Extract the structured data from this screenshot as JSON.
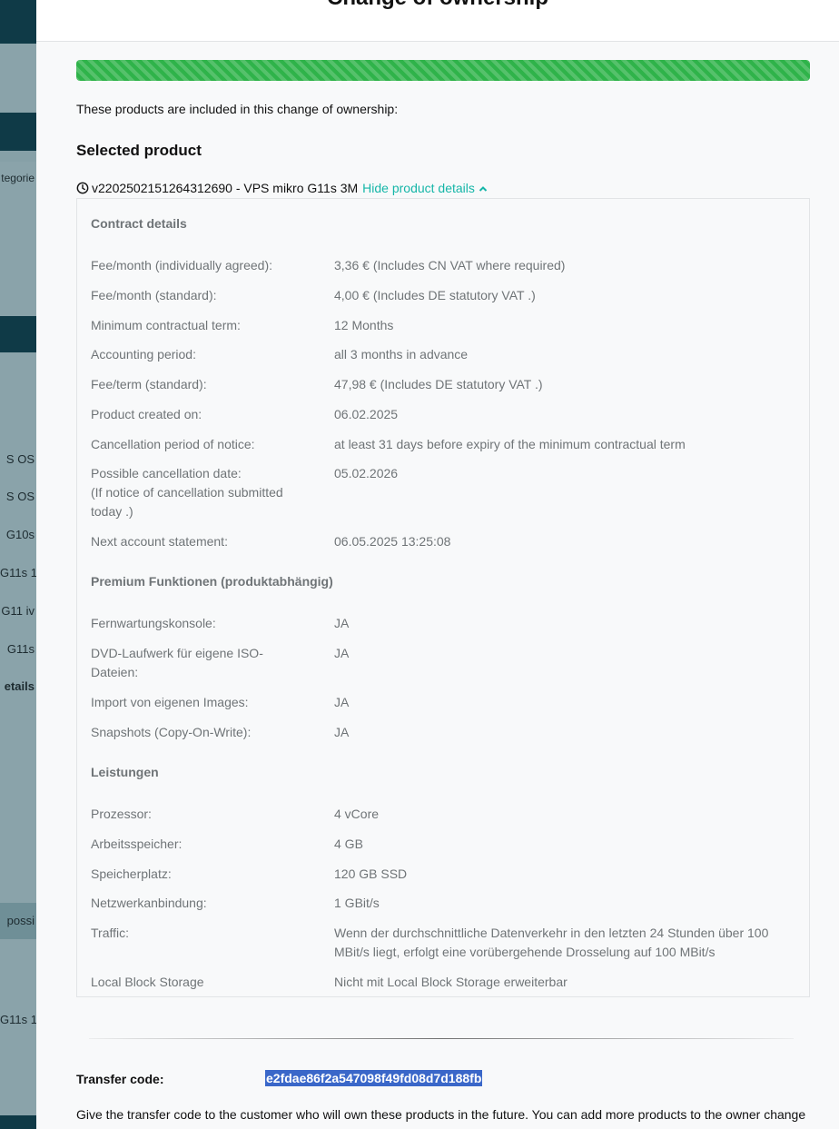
{
  "background": {
    "rows": [
      {
        "text": ""
      },
      {
        "text": ""
      },
      {
        "text": ""
      },
      {
        "text": "tegorie"
      },
      {
        "text": ""
      },
      {
        "text": ""
      },
      {
        "text": ""
      },
      {
        "text": ""
      },
      {
        "text": ""
      },
      {
        "text": ""
      },
      {
        "text": "S OS"
      },
      {
        "text": "S OS"
      },
      {
        "text": "G10s"
      },
      {
        "text": "G11s 1"
      },
      {
        "text": "G11 iv"
      },
      {
        "text": "G11s"
      },
      {
        "text": "etails"
      },
      {
        "text": ""
      },
      {
        "text": "possi"
      },
      {
        "text": ""
      },
      {
        "text": ""
      },
      {
        "text": "G11s 1"
      },
      {
        "text": ""
      },
      {
        "text": ""
      }
    ]
  },
  "modal": {
    "title": "Change of ownership",
    "progress_percent": 100,
    "intro": "These products are included in this change of ownership:",
    "section_title": "Selected product",
    "product": {
      "id_name": "v2202502151264312690 - VPS mikro G11s 3M",
      "toggle_label": "Hide product details"
    },
    "contract": {
      "title": "Contract details",
      "rows": [
        {
          "label": "Fee/month (individually agreed):",
          "value": "3,36 € (Includes CN VAT where required)"
        },
        {
          "label": "Fee/month (standard):",
          "value": "4,00 € (Includes DE statutory VAT .)"
        },
        {
          "label": "Minimum contractual term:",
          "value": "12 Months"
        },
        {
          "label": "Accounting period:",
          "value": "all 3 months in advance"
        },
        {
          "label": "Fee/term (standard):",
          "value": "47,98 € (Includes DE statutory VAT .)"
        },
        {
          "label": "Product created on:",
          "value": "06.02.2025"
        },
        {
          "label": "Cancellation period of notice:",
          "value": "at least 31 days before expiry of the minimum contractual term"
        },
        {
          "label": "Possible cancellation date:\n(If notice of cancellation submitted today .)",
          "value": "05.02.2026"
        },
        {
          "label": "Next account statement:",
          "value": "06.05.2025 13:25:08"
        }
      ]
    },
    "premium": {
      "title": "Premium Funktionen (produktabhängig)",
      "rows": [
        {
          "label": "Fernwartungskonsole:",
          "value": "JA"
        },
        {
          "label": "DVD-Laufwerk für eigene ISO-Dateien:",
          "value": "JA"
        },
        {
          "label": "Import von eigenen Images:",
          "value": "JA"
        },
        {
          "label": "Snapshots (Copy-On-Write):",
          "value": "JA"
        }
      ]
    },
    "services": {
      "title": "Leistungen",
      "rows": [
        {
          "label": "Prozessor:",
          "value": "4 vCore"
        },
        {
          "label": "Arbeitsspeicher:",
          "value": "4 GB"
        },
        {
          "label": "Speicherplatz:",
          "value": "120 GB SSD"
        },
        {
          "label": "Netzwerkanbindung:",
          "value": "1 GBit/s"
        },
        {
          "label": "Traffic:",
          "value": "Wenn der durchschnittliche Datenverkehr in den letzten 24 Stunden über 100 MBit/s liegt, erfolgt eine vorübergehende Drosselung auf 100 MBit/s"
        },
        {
          "label": "Local Block Storage",
          "value": "Nicht mit Local Block Storage erweiterbar"
        }
      ]
    },
    "transfer": {
      "label": "Transfer code:",
      "code": "e2fdae86f2a547098f49fd08d7d188fb",
      "instructions": "Give the transfer code to the customer who will own these products in the future. You can add more products to the owner change"
    }
  }
}
